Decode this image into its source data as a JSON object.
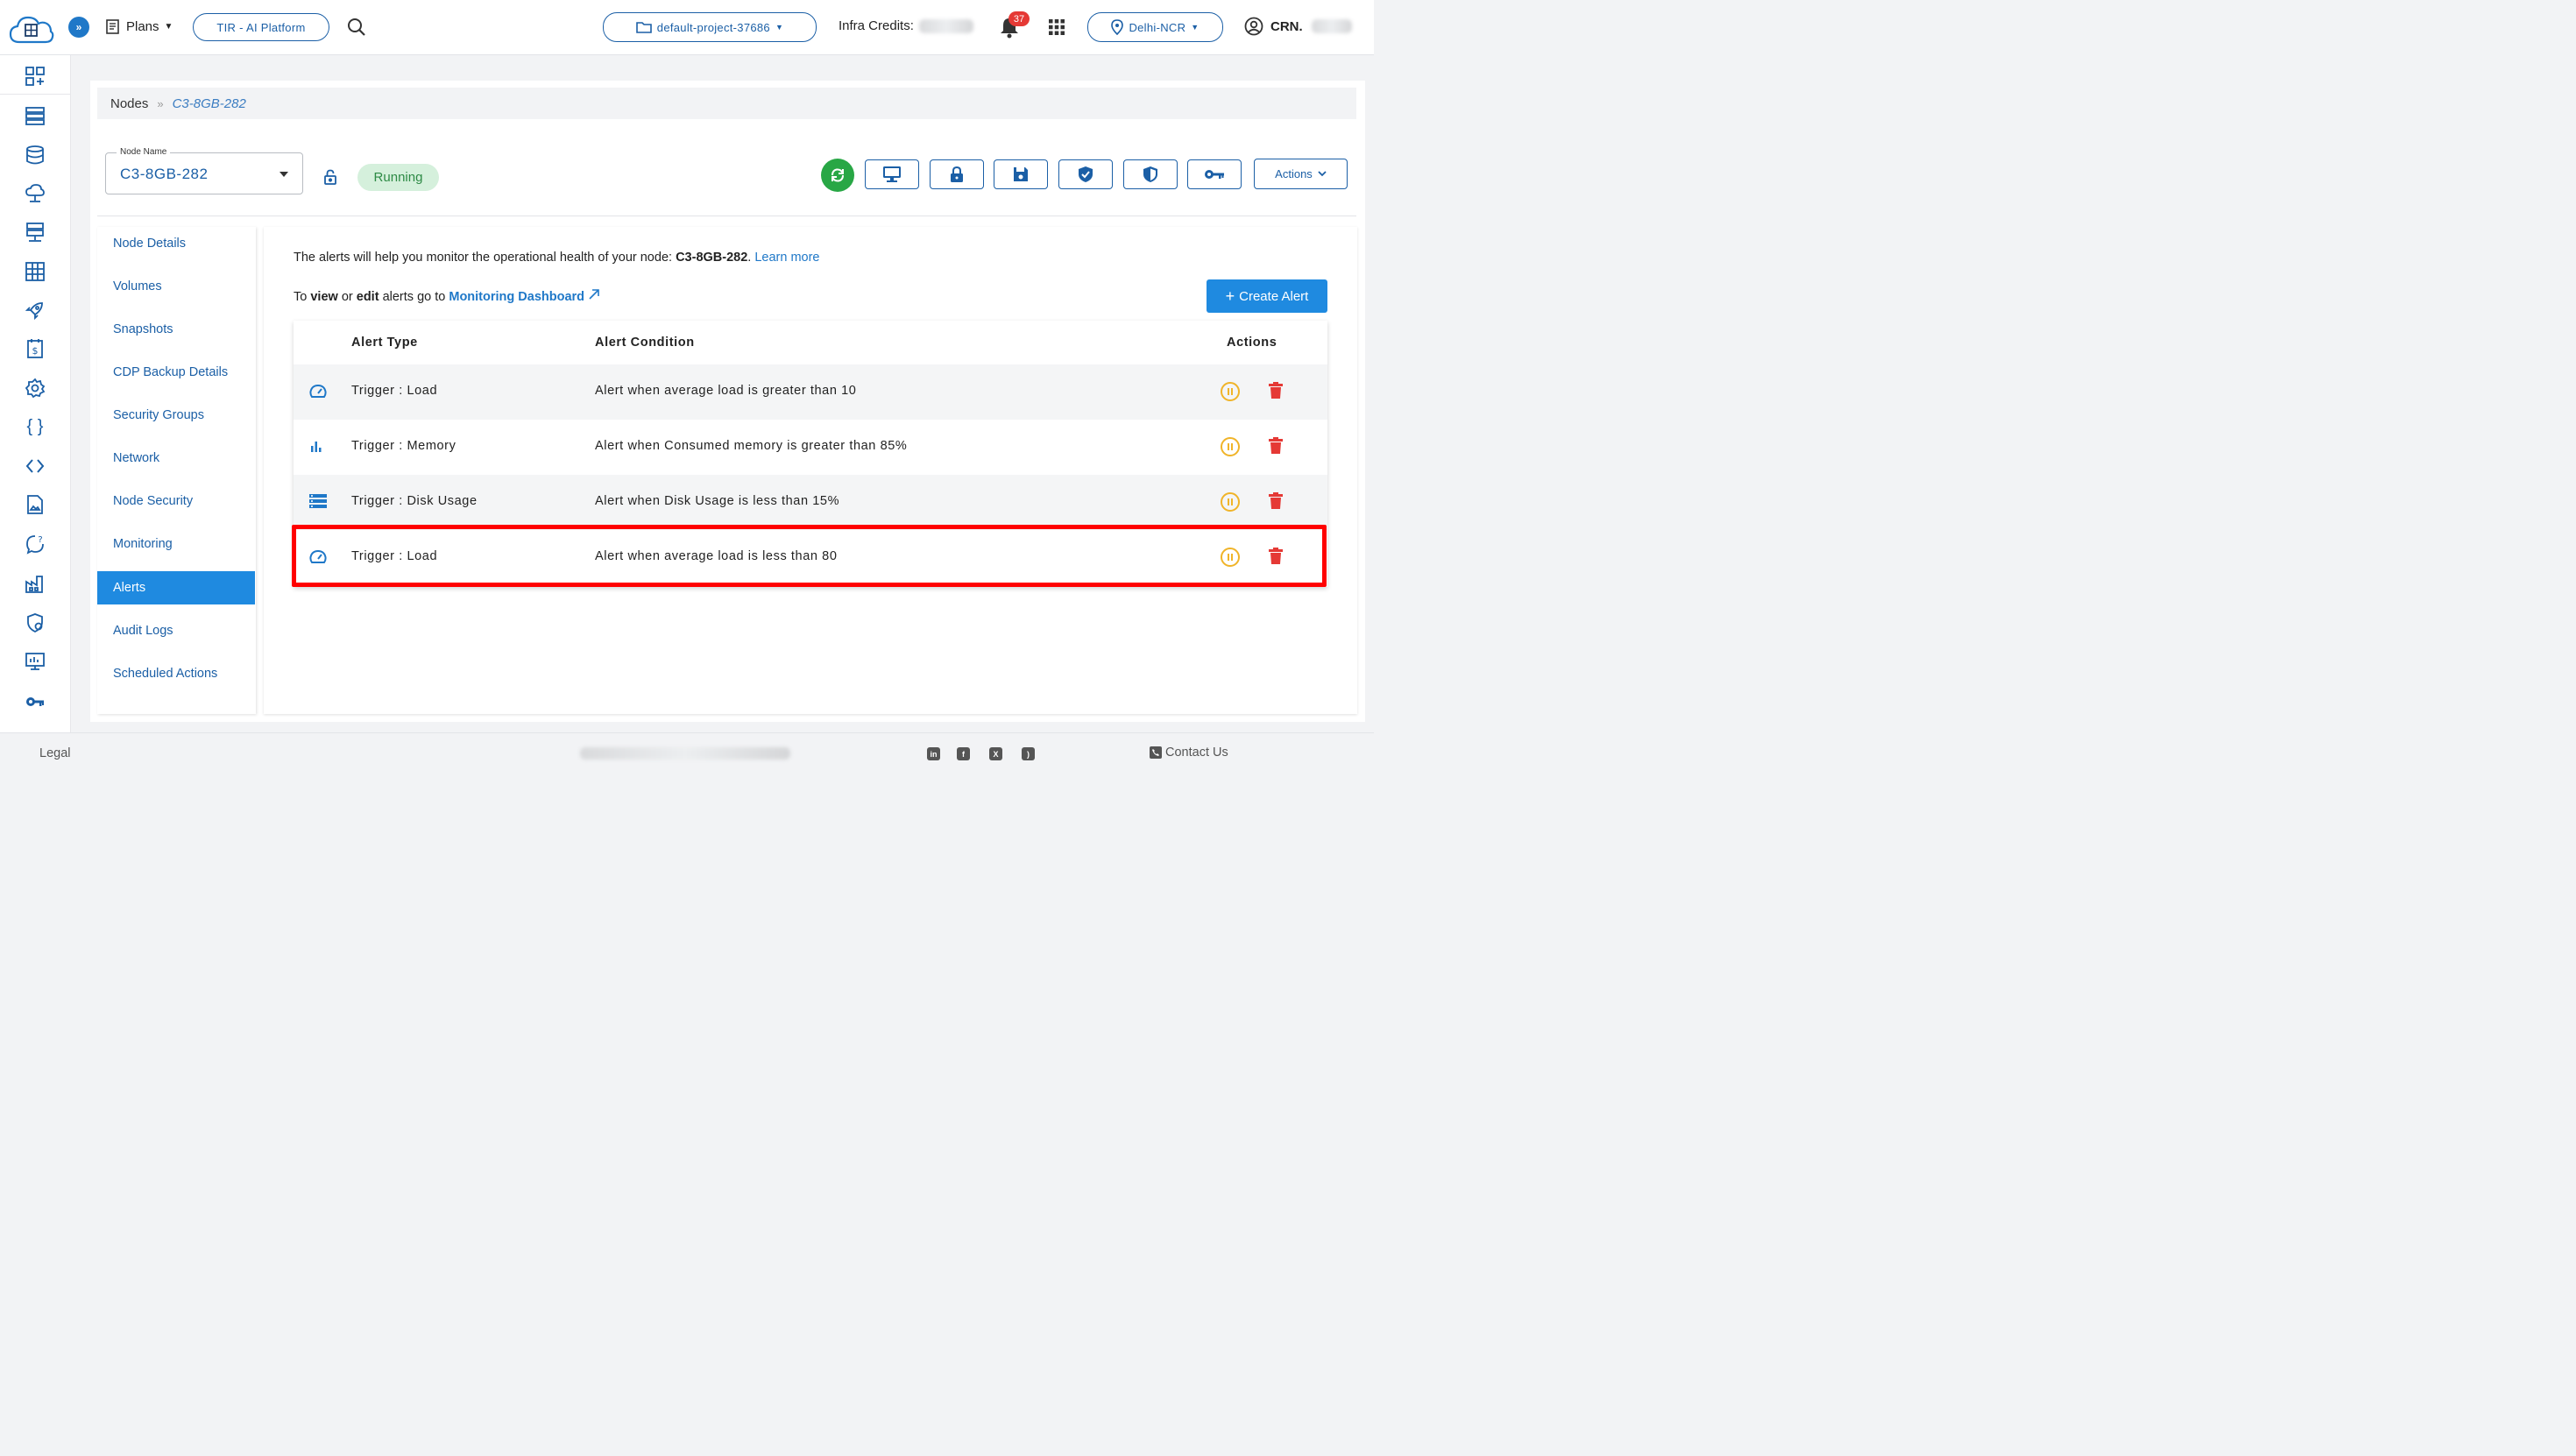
{
  "header": {
    "plans_label": "Plans",
    "platform_label": "TIR - AI Platform",
    "project_label": "default-project-37686",
    "credits_label": "Infra Credits:",
    "notification_count": "37",
    "region_label": "Delhi-NCR",
    "user_label": "CRN."
  },
  "breadcrumb": {
    "root": "Nodes",
    "separator": "»",
    "current": "C3-8GB-282"
  },
  "node": {
    "field_label": "Node Name",
    "name": "C3-8GB-282",
    "status": "Running",
    "actions_label": "Actions"
  },
  "sidenav": {
    "items": [
      {
        "label": "Node Details"
      },
      {
        "label": "Volumes"
      },
      {
        "label": "Snapshots"
      },
      {
        "label": "CDP Backup Details"
      },
      {
        "label": "Security Groups"
      },
      {
        "label": "Network"
      },
      {
        "label": "Node Security"
      },
      {
        "label": "Monitoring"
      },
      {
        "label": "Alerts"
      },
      {
        "label": "Audit Logs"
      },
      {
        "label": "Scheduled Actions"
      }
    ],
    "active": "Alerts"
  },
  "alerts": {
    "intro_text": "The alerts will help you monitor the operational health of your node:",
    "intro_node": "C3-8GB-282",
    "learn_more": "Learn more",
    "to_text": "To",
    "view_word": "view",
    "or_word": "or",
    "edit_word": "edit",
    "go_text": "alerts go to",
    "dashboard_link": "Monitoring Dashboard",
    "create_label": "Create Alert",
    "columns": {
      "type": "Alert Type",
      "condition": "Alert Condition",
      "actions": "Actions"
    },
    "rows": [
      {
        "icon": "gauge-icon",
        "type": "Trigger : Load",
        "condition": "Alert when average load is greater than 10"
      },
      {
        "icon": "bar-chart-icon",
        "type": "Trigger : Memory",
        "condition": "Alert when Consumed memory is greater than 85%"
      },
      {
        "icon": "storage-icon",
        "type": "Trigger : Disk Usage",
        "condition": "Alert when Disk Usage is less than 15%"
      },
      {
        "icon": "gauge-icon",
        "type": "Trigger : Load",
        "condition": "Alert when average load is less than 80"
      }
    ]
  },
  "footer": {
    "legal": "Legal",
    "contact": "Contact Us"
  },
  "colors": {
    "primary": "#1f8ae0",
    "accent_dark": "#1b5fa6",
    "running_bg": "#d5f0dc",
    "running_text": "#2d8a45",
    "highlight": "#ff0000",
    "pause": "#f0b429",
    "delete": "#e53935"
  }
}
